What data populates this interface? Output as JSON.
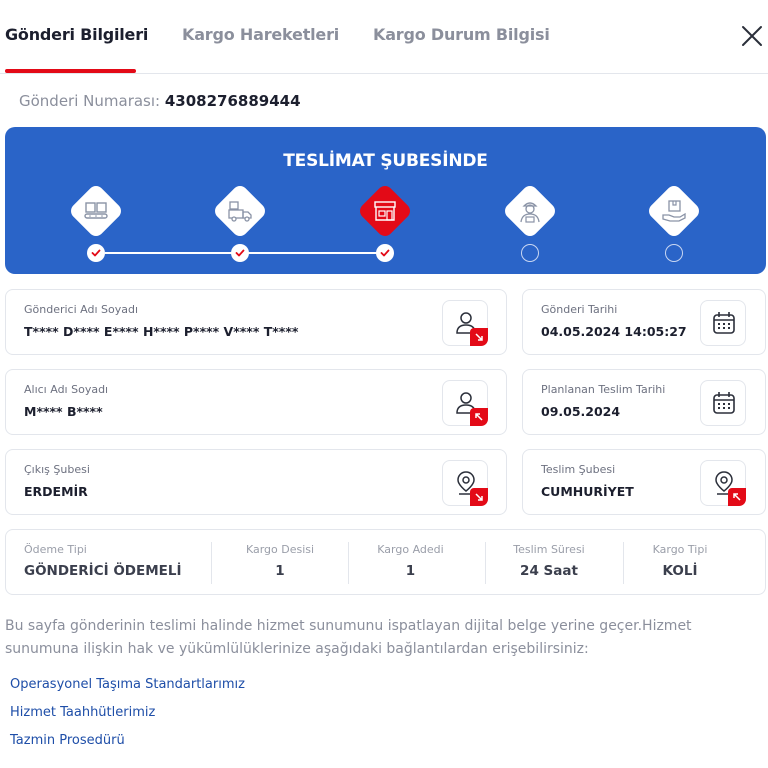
{
  "tabs": [
    {
      "label": "Gönderi Bilgileri"
    },
    {
      "label": "Kargo Hareketleri"
    },
    {
      "label": "Kargo Durum Bilgisi"
    }
  ],
  "shipment": {
    "label": "Gönderi Numarası:",
    "number": "4308276889444"
  },
  "tracker": {
    "status": "TESLİMAT ŞUBESİNDE",
    "steps": [
      {
        "icon": "warehouse-conveyor-icon",
        "done": true
      },
      {
        "icon": "truck-icon",
        "done": true
      },
      {
        "icon": "branch-store-icon",
        "done": true,
        "active": true
      },
      {
        "icon": "courier-icon",
        "done": false
      },
      {
        "icon": "delivered-box-hand-icon",
        "done": false
      }
    ]
  },
  "cards": {
    "sender": {
      "label": "Gönderici Adı Soyadı",
      "value": "T**** D**** E**** H**** P**** V**** T****"
    },
    "send_date": {
      "label": "Gönderi Tarihi",
      "value": "04.05.2024 14:05:27"
    },
    "receiver": {
      "label": "Alıcı Adı Soyadı",
      "value": "M**** B****"
    },
    "planned_date": {
      "label": "Planlanan Teslim Tarihi",
      "value": "09.05.2024"
    },
    "origin_branch": {
      "label": "Çıkış Şubesi",
      "value": "ERDEMİR"
    },
    "delivery_branch": {
      "label": "Teslim Şubesi",
      "value": "CUMHURİYET"
    }
  },
  "summary": [
    {
      "label": "Ödeme Tipi",
      "value": "GÖNDERİCİ ÖDEMELİ"
    },
    {
      "label": "Kargo Desisi",
      "value": "1"
    },
    {
      "label": "Kargo Adedi",
      "value": "1"
    },
    {
      "label": "Teslim Süresi",
      "value": "24 Saat"
    },
    {
      "label": "Kargo Tipi",
      "value": "KOLİ"
    }
  ],
  "info_text": "Bu sayfa gönderinin teslimi halinde hizmet sunumunu ispatlayan dijital belge yerine geçer.Hizmet sunumuna ilişkin hak ve yükümlülüklerinize aşağıdaki bağlantılardan erişebilirsiniz:",
  "links": [
    {
      "label": "Operasyonel Taşıma Standartlarımız"
    },
    {
      "label": "Hizmet Taahhütlerimiz"
    },
    {
      "label": "Tazmin Prosedürü"
    }
  ],
  "colors": {
    "accent_red": "#e30a17",
    "tracker_blue": "#2a64c8",
    "link_blue": "#1e4ea8"
  }
}
